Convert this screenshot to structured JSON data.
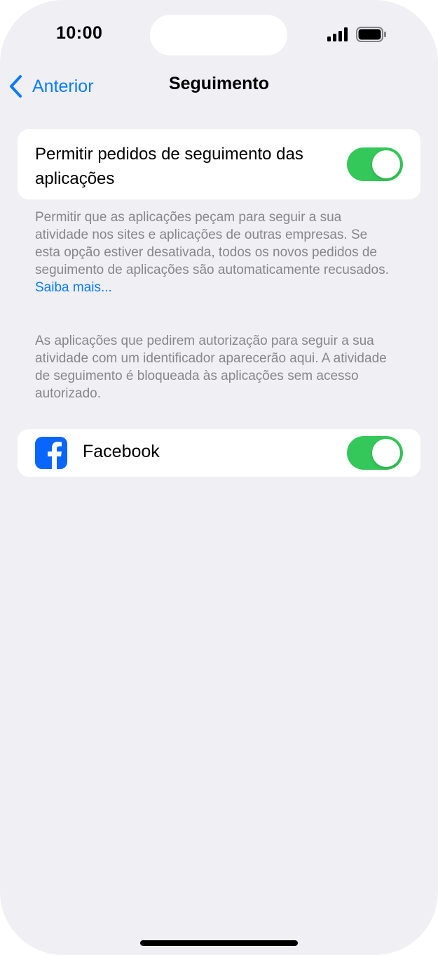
{
  "status_bar": {
    "time": "10:00",
    "signal_icon": "cellular-signal-icon",
    "battery_icon": "battery-icon"
  },
  "nav": {
    "back_label": "Anterior",
    "back_icon": "chevron-left-icon",
    "title": "Seguimento"
  },
  "tracking": {
    "allow_label": "Permitir pedidos de seguimento das aplicações",
    "allow_enabled": true,
    "description": "Permitir que as aplicações peçam para seguir a sua atividade nos sites e aplicações de outras empresas. Se esta opção estiver desativada, todos os novos pedidos de seguimento de aplicações são automaticamente recusados.",
    "learn_more": "Saiba mais..."
  },
  "apps_section": {
    "description": "As aplicações que pedirem autorização para seguir a sua atividade com um identificador aparecerão aqui. A atividade de seguimento é bloqueada às aplicações sem acesso autorizado.",
    "apps": [
      {
        "name": "Facebook",
        "icon": "facebook-icon",
        "enabled": true
      }
    ]
  },
  "colors": {
    "accent": "#0a7cff",
    "toggle_on": "#34c759",
    "background": "#efeff4",
    "footer_text": "#86868b",
    "facebook_blue": "#0866ff"
  }
}
